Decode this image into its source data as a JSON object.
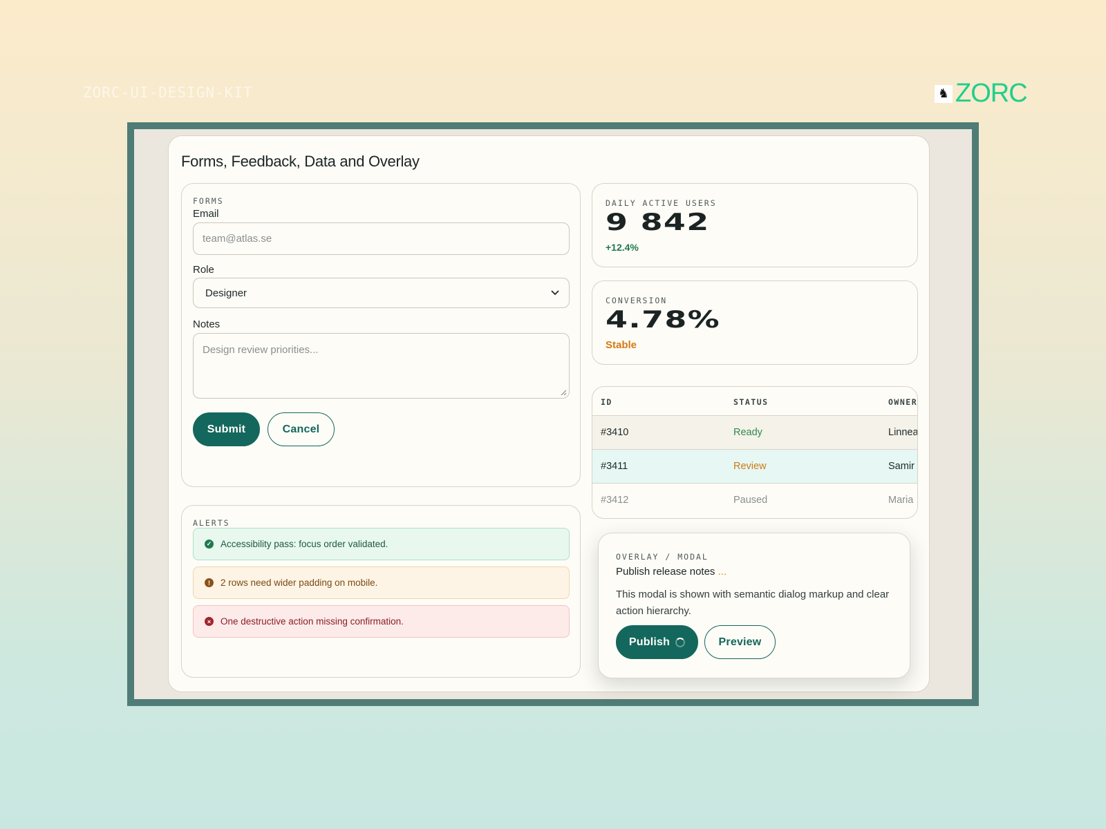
{
  "page": {
    "kit_label": "ZORC-UI-DESIGN-KIT",
    "brand": "ZORC",
    "title": "Forms, Feedback, Data and Overlay"
  },
  "forms": {
    "eyebrow": "FORMS",
    "email_label": "Email",
    "email_placeholder": "team@atlas.se",
    "role_label": "Role",
    "role_value": "Designer",
    "notes_label": "Notes",
    "notes_placeholder": "Design review priorities...",
    "submit_label": "Submit",
    "cancel_label": "Cancel"
  },
  "alerts": {
    "eyebrow": "ALERTS",
    "items": [
      {
        "type": "success",
        "text": "Accessibility pass: focus order validated."
      },
      {
        "type": "warning",
        "text": "2 rows need wider padding on mobile."
      },
      {
        "type": "danger",
        "text": "One destructive action missing confirmation."
      }
    ]
  },
  "stats": [
    {
      "label": "DAILY ACTIVE USERS",
      "value": "9 842",
      "delta": "+12.4%",
      "delta_color": "#1f7a4e"
    },
    {
      "label": "CONVERSION",
      "value": "4.78%",
      "delta": "Stable",
      "delta_color": "#d67a12"
    }
  ],
  "table": {
    "columns": [
      "ID",
      "STATUS",
      "OWNER"
    ],
    "rows": [
      {
        "id": "#3410",
        "status": "Ready",
        "owner": "Linnea",
        "status_color": "#2e8a4e"
      },
      {
        "id": "#3411",
        "status": "Review",
        "owner": "Samir",
        "status_color": "#cf7a12"
      },
      {
        "id": "#3412",
        "status": "Paused",
        "owner": "Maria",
        "status_color": "#8a8f8f"
      }
    ]
  },
  "modal": {
    "eyebrow": "OVERLAY / MODAL",
    "title": "Publish release notes",
    "title_suffix": "...",
    "body": "This modal is shown with semantic dialog markup and clear action hierarchy.",
    "publish_label": "Publish",
    "preview_label": "Preview"
  },
  "colors": {
    "accent": "#14675c",
    "frame": "#4f7c76",
    "brand": "#1fcf8a"
  },
  "icons": {
    "brand_mark": "zorc-creature-icon",
    "select_chevron": "chevron-down-icon",
    "success": "check-circle-icon",
    "warning": "exclamation-circle-icon",
    "danger": "x-circle-icon",
    "spinner": "spinner-icon"
  }
}
